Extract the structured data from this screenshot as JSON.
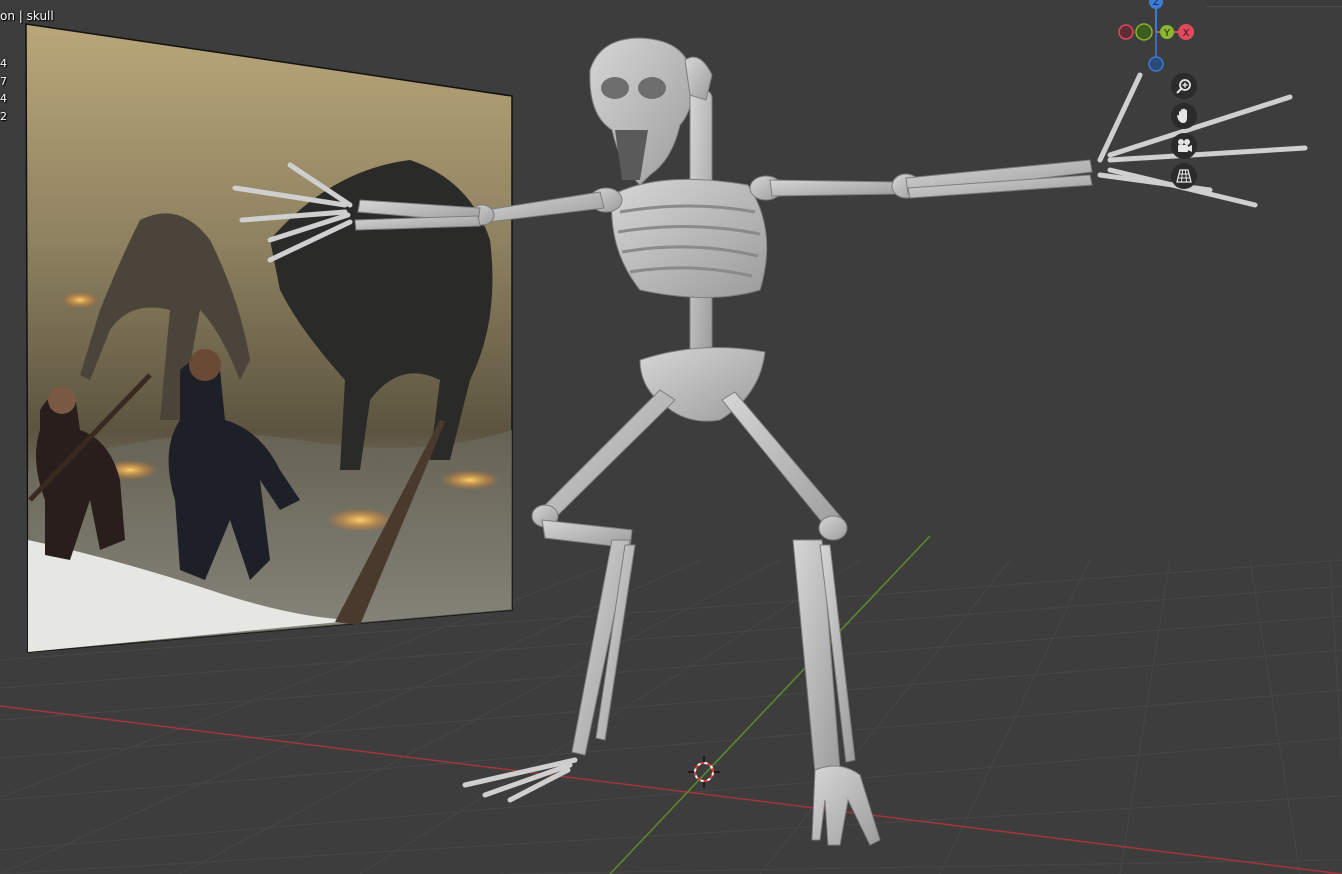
{
  "viewport": {
    "header_text": "on | skull",
    "stats": [
      "4",
      "7",
      "4",
      "2"
    ],
    "gizmo": {
      "z_label": "Z",
      "y_label": "Y",
      "x_label": "X",
      "colors": {
        "x": "#e04a5c",
        "y": "#8ab632",
        "z": "#3b7bd6"
      }
    },
    "nav_buttons": [
      {
        "name": "zoom-icon"
      },
      {
        "name": "hand-pan-icon"
      },
      {
        "name": "camera-icon"
      },
      {
        "name": "perspective-grid-icon"
      }
    ],
    "colors": {
      "background": "#3d3d3d",
      "grid": "#474747",
      "x_axis": "#a5353d",
      "y_axis": "#5f8a2a",
      "bone": "#bcbcbc"
    }
  }
}
